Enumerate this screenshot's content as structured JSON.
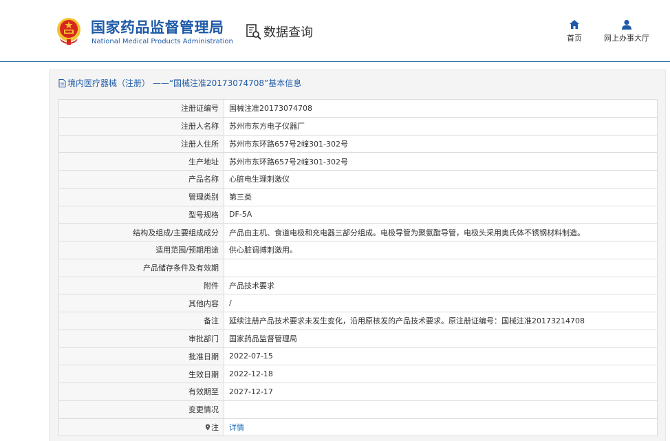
{
  "header": {
    "org_name_cn": "国家药品监督管理局",
    "org_name_en": "National Medical Products Administration",
    "data_query_label": "数据查询",
    "nav": [
      {
        "label": "首页",
        "icon": "home-icon"
      },
      {
        "label": "网上办事大厅",
        "icon": "user-icon"
      }
    ]
  },
  "panel": {
    "title": "境内医疗器械（注册） ——“国械注准20173074708”基本信息",
    "title_icon": "document-icon"
  },
  "rows": [
    {
      "label": "注册证编号",
      "value": "国械注准20173074708"
    },
    {
      "label": "注册人名称",
      "value": "苏州市东方电子仪器厂"
    },
    {
      "label": "注册人住所",
      "value": "苏州市东环路657号2幢301-302号"
    },
    {
      "label": "生产地址",
      "value": "苏州市东环路657号2幢301-302号"
    },
    {
      "label": "产品名称",
      "value": "心脏电生理刺激仪"
    },
    {
      "label": "管理类别",
      "value": "第三类"
    },
    {
      "label": "型号规格",
      "value": "DF-5A"
    },
    {
      "label": "结构及组成/主要组成成分",
      "value": "产品由主机、食道电极和充电器三部分组成。电极导管为聚氨酯导管，电极头采用奥氏体不锈钢材料制造。"
    },
    {
      "label": "适用范围/预期用途",
      "value": "供心脏调搏刺激用。"
    },
    {
      "label": "产品储存条件及有效期",
      "value": ""
    },
    {
      "label": "附件",
      "value": "产品技术要求"
    },
    {
      "label": "其他内容",
      "value": "/"
    },
    {
      "label": "备注",
      "value": "延续注册产品技术要求未发生变化，沿用原核发的产品技术要求。原注册证编号：国械注准20173214708"
    },
    {
      "label": "审批部门",
      "value": "国家药品监督管理局"
    },
    {
      "label": "批准日期",
      "value": "2022-07-15"
    },
    {
      "label": "生效日期",
      "value": "2022-12-18"
    },
    {
      "label": "有效期至",
      "value": "2027-12-17"
    },
    {
      "label": "变更情况",
      "value": ""
    },
    {
      "label": "注",
      "value": "详情",
      "label_icon": "pin-icon",
      "value_is_link": true
    }
  ],
  "colors": {
    "brand_blue": "#1e5aa8",
    "link_blue": "#1e6fb8",
    "header_rule": "#2c6fa8",
    "emblem_red": "#d7261e",
    "emblem_gold": "#f2c230"
  }
}
